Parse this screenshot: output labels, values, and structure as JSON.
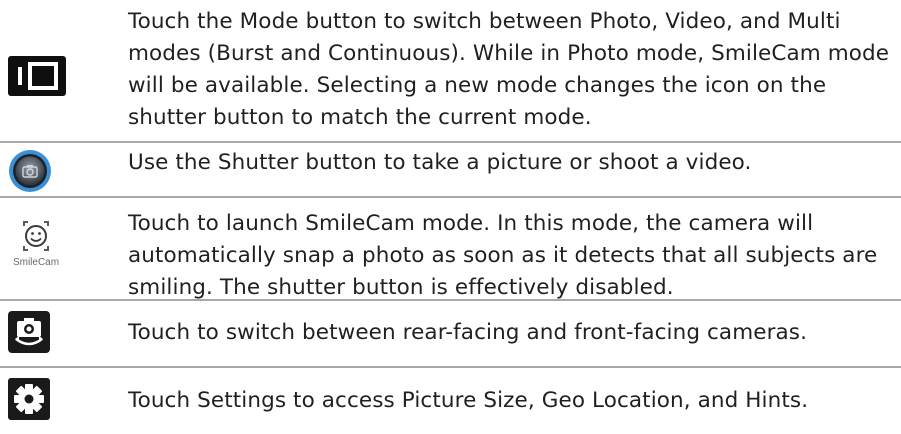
{
  "rows": [
    {
      "icon": "mode-icon",
      "text": "Touch the Mode button to switch between Photo, Video, and Multi modes (Burst and Continuous). While in Photo mode, SmileCam mode will be available. Selecting a new mode changes the icon on the shutter button to match the current mode."
    },
    {
      "icon": "shutter-icon",
      "text": "Use the Shutter button to take a picture or shoot a video."
    },
    {
      "icon": "smilecam-icon",
      "icon_caption": "SmileCam",
      "text": "Touch to launch SmileCam mode. In this mode, the camera will automatically snap a photo as soon as it detects that all subjects are smiling. The shutter button is effectively disabled."
    },
    {
      "icon": "switch-camera-icon",
      "text": "Touch to switch between rear-facing and front-facing cameras."
    },
    {
      "icon": "settings-gear-icon",
      "text": "Touch Settings to access Picture Size, Geo Location, and Hints."
    }
  ],
  "colors": {
    "text": "#231f20",
    "divider": "#a7a9ac",
    "icon_background": "#1a1a1a",
    "shutter_ring": "#3a8fd6"
  }
}
